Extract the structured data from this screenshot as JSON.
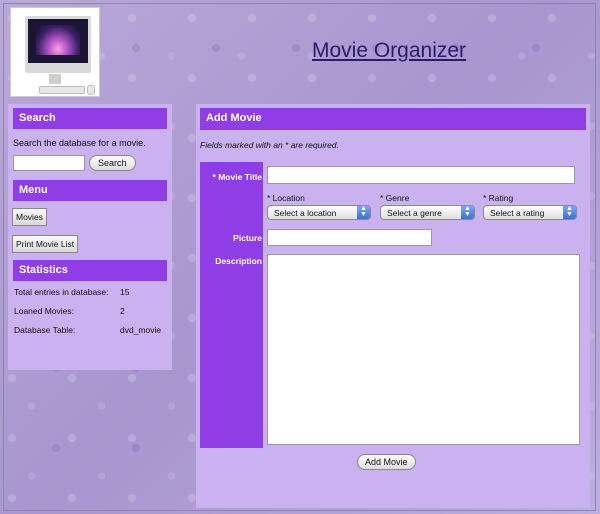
{
  "header": {
    "title": "Movie Organizer"
  },
  "sidebar": {
    "search": {
      "heading": "Search",
      "description": "Search the database for a movie.",
      "input_value": "",
      "button_label": "Search"
    },
    "menu": {
      "heading": "Menu",
      "items": [
        {
          "label": "Movies"
        },
        {
          "label": "Print Movie List"
        }
      ]
    },
    "statistics": {
      "heading": "Statistics",
      "rows": [
        {
          "label": "Total entries in database:",
          "value": "15"
        },
        {
          "label": "Loaned Movies:",
          "value": "2"
        },
        {
          "label": "Database Table:",
          "value": "dvd_movie"
        }
      ]
    }
  },
  "form": {
    "heading": "Add Movie",
    "required_note": "Fields marked with an * are required.",
    "labels": {
      "title": "* Movie Title",
      "picture": "Picture",
      "description": "Description"
    },
    "fields": {
      "title_value": "",
      "picture_value": "",
      "description_value": ""
    },
    "selects": {
      "location": {
        "caption": "* Location",
        "selected": "Select a location"
      },
      "genre": {
        "caption": "* Genre",
        "selected": "Select a genre"
      },
      "rating": {
        "caption": "* Rating",
        "selected": "Select a rating"
      }
    },
    "submit_label": "Add Movie"
  },
  "colors": {
    "accent": "#8f3ee6",
    "panel": "#c9b2ef",
    "title_link": "#2e1a6b"
  },
  "icons": {
    "logo": "imac-computer-image",
    "select_arrow": "up-down-arrow-icon"
  }
}
